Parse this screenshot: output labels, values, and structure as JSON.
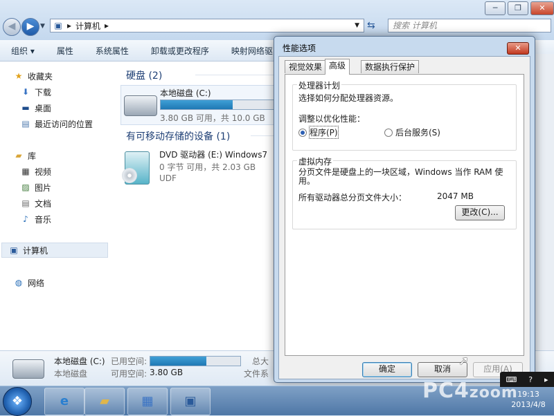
{
  "explorer": {
    "window_controls": {
      "minimize": "─",
      "maximize": "❐",
      "close": "✕"
    },
    "address": {
      "path": "计算机",
      "separator": "▸"
    },
    "search": {
      "placeholder": "搜索 计算机"
    },
    "toolbar": [
      "组织 ▾",
      "属性",
      "系统属性",
      "卸载或更改程序",
      "映射网络驱"
    ],
    "nav": {
      "favorites": "收藏夹",
      "favorites_items": [
        "下载",
        "桌面",
        "最近访问的位置"
      ],
      "libraries": "库",
      "libraries_items": [
        "视频",
        "图片",
        "文档",
        "音乐"
      ],
      "computer": "计算机",
      "network": "网络"
    },
    "hdd_group": "硬盘 (2)",
    "local_disk": {
      "name": "本地磁盘 (C:)",
      "usage": "3.80 GB 可用，共 10.0 GB",
      "used_fraction": 0.62
    },
    "removable_group": "有可移动存储的设备 (1)",
    "dvd": {
      "name": "DVD 驱动器 (E:) Windows7",
      "usage": "0 字节 可用，共 2.03 GB",
      "fs": "UDF"
    },
    "details": {
      "title": "本地磁盘 (C:)",
      "type": "本地磁盘",
      "used_label": "已用空间:",
      "free_label": "可用空间:",
      "free_value": "3.80 GB",
      "used_fraction": 0.62,
      "total_label": "总大",
      "fs_label": "文件系"
    }
  },
  "dialog": {
    "title": "性能选项",
    "close": "✕",
    "tabs": [
      "视觉效果",
      "高级",
      "数据执行保护"
    ],
    "active_tab": "高级",
    "processor": {
      "legend": "处理器计划",
      "desc": "选择如何分配处理器资源。",
      "adjust_label": "调整以优化性能：",
      "option_programs": "程序(P)",
      "option_background": "后台服务(S)",
      "selected": "程序(P)"
    },
    "vm": {
      "legend": "虚拟内存",
      "desc": "分页文件是硬盘上的一块区域，Windows 当作 RAM 使用。",
      "total_label": "所有驱动器总分页文件大小：",
      "total_value": "2047 MB",
      "change_button": "更改(C)..."
    },
    "buttons": {
      "ok": "确定",
      "cancel": "取消",
      "apply": "应用(A)"
    }
  },
  "taskbar": {
    "start": "❖",
    "watermark_main": "PC4",
    "watermark_sub": "zoom",
    "clock_time": "19:13",
    "clock_date": "2013/4/8"
  }
}
